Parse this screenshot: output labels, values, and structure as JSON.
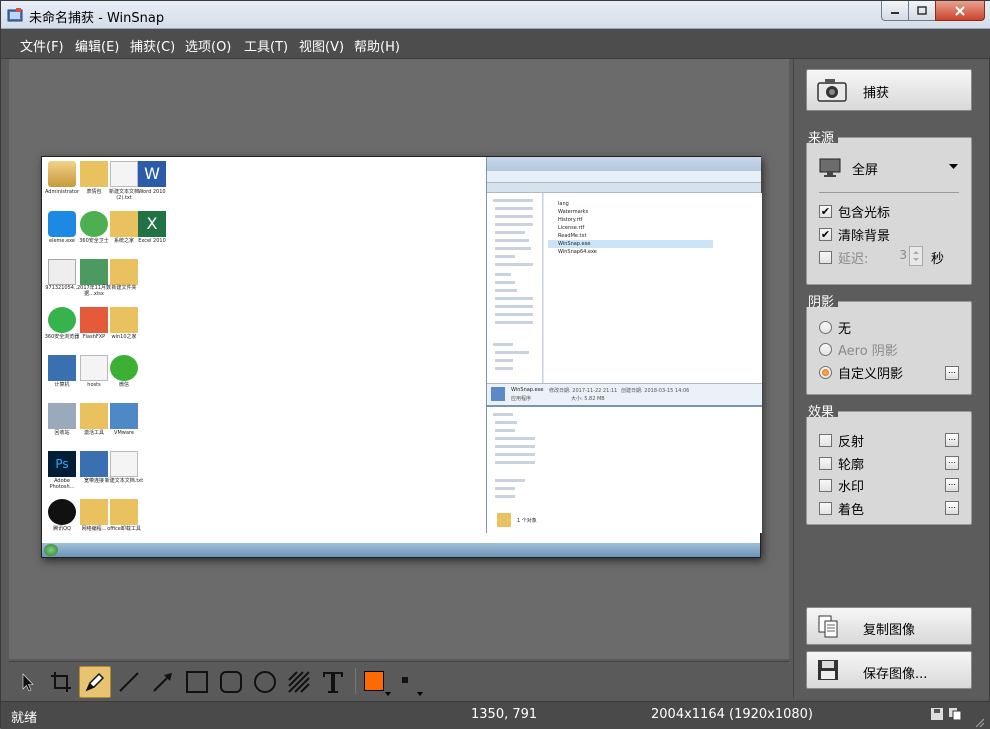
{
  "window": {
    "title": "未命名捕获 - WinSnap"
  },
  "menu": [
    "文件(F)",
    "编辑(E)",
    "捕获(C)",
    "选项(O)",
    "工具(T)",
    "视图(V)",
    "帮助(H)"
  ],
  "panel": {
    "capture_button": "捕获",
    "source": {
      "title": "来源",
      "mode": "全屏",
      "include_cursor": "包含光标",
      "include_cursor_checked": true,
      "clear_background": "清除背景",
      "clear_background_checked": true,
      "delay_label": "延迟:",
      "delay_checked": false,
      "delay_value": "3",
      "delay_unit": "秒"
    },
    "shadow": {
      "title": "阴影",
      "none": "无",
      "aero": "Aero 阴影",
      "custom": "自定义阴影",
      "selected": "custom"
    },
    "effects": {
      "title": "效果",
      "items": [
        "反射",
        "轮廓",
        "水印",
        "着色"
      ]
    },
    "copy_button": "复制图像",
    "save_button": "保存图像..."
  },
  "toolbar": {
    "tools": [
      "select-tool",
      "crop-tool",
      "pen-tool",
      "line-tool",
      "arrow-tool",
      "rectangle-tool",
      "rounded-rectangle-tool",
      "ellipse-tool",
      "hatch-tool",
      "text-tool"
    ],
    "active_tool": "pen-tool",
    "color": "#ff6a00"
  },
  "status": {
    "state": "就绪",
    "cursor": "1350, 791",
    "size": "2004x1164 (1920x1080)"
  },
  "screenshot": {
    "desktop_icons": [
      "Administrator",
      "表情包",
      "新建文本文档 (2).txt",
      "Word 2010",
      "eleme.exe",
      "360安全卫士",
      "系统之家",
      "Excel 2010",
      "971321054...",
      "2017年11月数据...xlsx",
      "新建文件夹",
      "360安全浏览器",
      "FlashFXP",
      "win10之家",
      "计算机",
      "hosts",
      "微信",
      "回收站",
      "激活工具",
      "VMware",
      "Adobe Photosh...",
      "宽带连接",
      "新建文本文档.txt",
      "腾讯QQ",
      "网络编程...",
      "office卸载工具"
    ],
    "explorer_files": [
      "lang",
      "Watermarks",
      "History.rtf",
      "License.rtf",
      "ReadMe.txt",
      "WinSnap.exe",
      "WinSnap64.exe"
    ],
    "explorer_selected": "WinSnap.exe",
    "explorer_status": "1 个对象",
    "explorer_detail_name": "WinSnap.exe",
    "explorer_detail_date": "修改日期: 2017-11-22 21:11",
    "explorer_detail_size": "大小: 5.82 MB",
    "explorer_detail_created": "创建日期: 2018-03-15 14:06",
    "explorer_detail_type": "应用程序"
  }
}
